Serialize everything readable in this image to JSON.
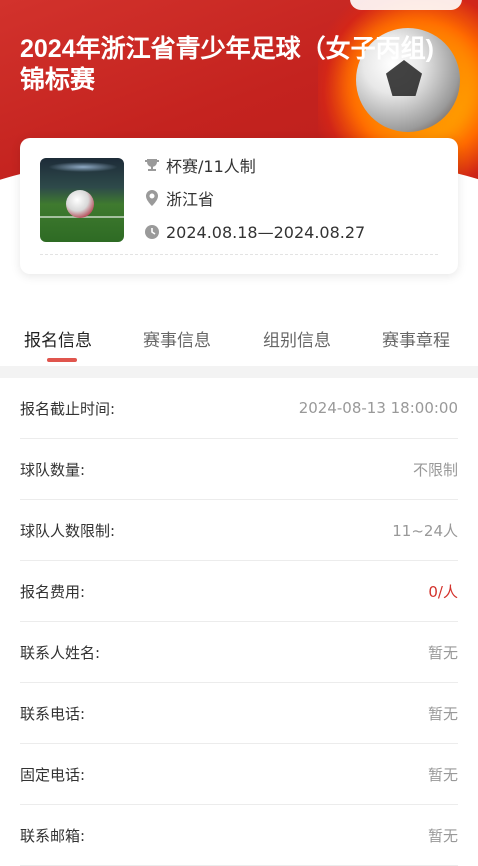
{
  "event": {
    "title": "2024年浙江省青少年足球（女子丙组)锦标赛",
    "type": "杯赛/11人制",
    "location": "浙江省",
    "dates": "2024.08.18—2024.08.27"
  },
  "tabs": [
    {
      "label": "报名信息",
      "active": true
    },
    {
      "label": "赛事信息",
      "active": false
    },
    {
      "label": "组别信息",
      "active": false
    },
    {
      "label": "赛事章程",
      "active": false
    }
  ],
  "registration": [
    {
      "label": "报名截止时间:",
      "value": "2024-08-13 18:00:00"
    },
    {
      "label": "球队数量:",
      "value": "不限制"
    },
    {
      "label": "球队人数限制:",
      "value": "11~24人"
    },
    {
      "label": "报名费用:",
      "value": "0/人"
    },
    {
      "label": "联系人姓名:",
      "value": "暂无"
    },
    {
      "label": "联系电话:",
      "value": "暂无"
    },
    {
      "label": "固定电话:",
      "value": "暂无"
    },
    {
      "label": "联系邮箱:",
      "value": "暂无"
    }
  ],
  "colors": {
    "brand_red": "#c4231f",
    "accent": "#e0554d",
    "fee_red": "#d3322c"
  },
  "icons": {
    "type": "trophy-icon",
    "location": "location-pin-icon",
    "dates": "clock-icon"
  }
}
